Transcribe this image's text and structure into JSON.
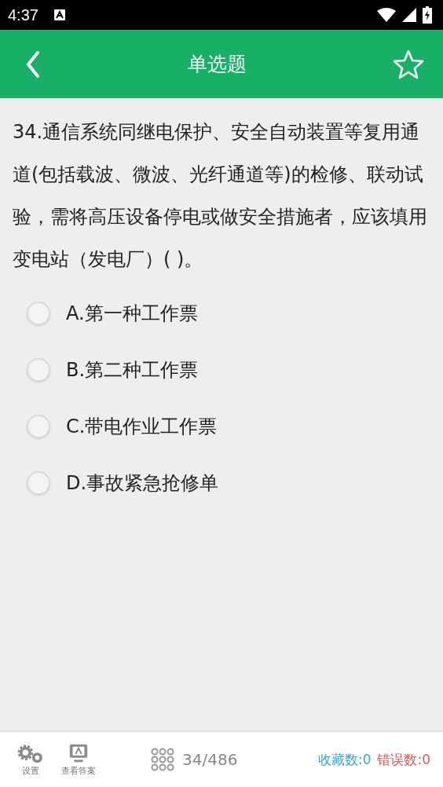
{
  "status_bar": {
    "time": "4:37"
  },
  "header": {
    "title": "单选题",
    "starred": false
  },
  "question": {
    "text": "34.通信系统同继电保护、安全自动装置等复用通道(包括载波、微波、光纤通道等)的检修、联动试验，需将高压设备停电或做安全措施者，应该填用变电站（发电厂）( )。"
  },
  "options": [
    {
      "label": "A.第一种工作票",
      "selected": false
    },
    {
      "label": "B.第二种工作票",
      "selected": false
    },
    {
      "label": "C.带电作业工作票",
      "selected": false
    },
    {
      "label": "D.事故紧急抢修单",
      "selected": false
    }
  ],
  "bottom_bar": {
    "settings": "设置",
    "answer": "查看答案",
    "progress": "34/486",
    "favorites": "收藏数:0",
    "errors": "错误数:0"
  }
}
